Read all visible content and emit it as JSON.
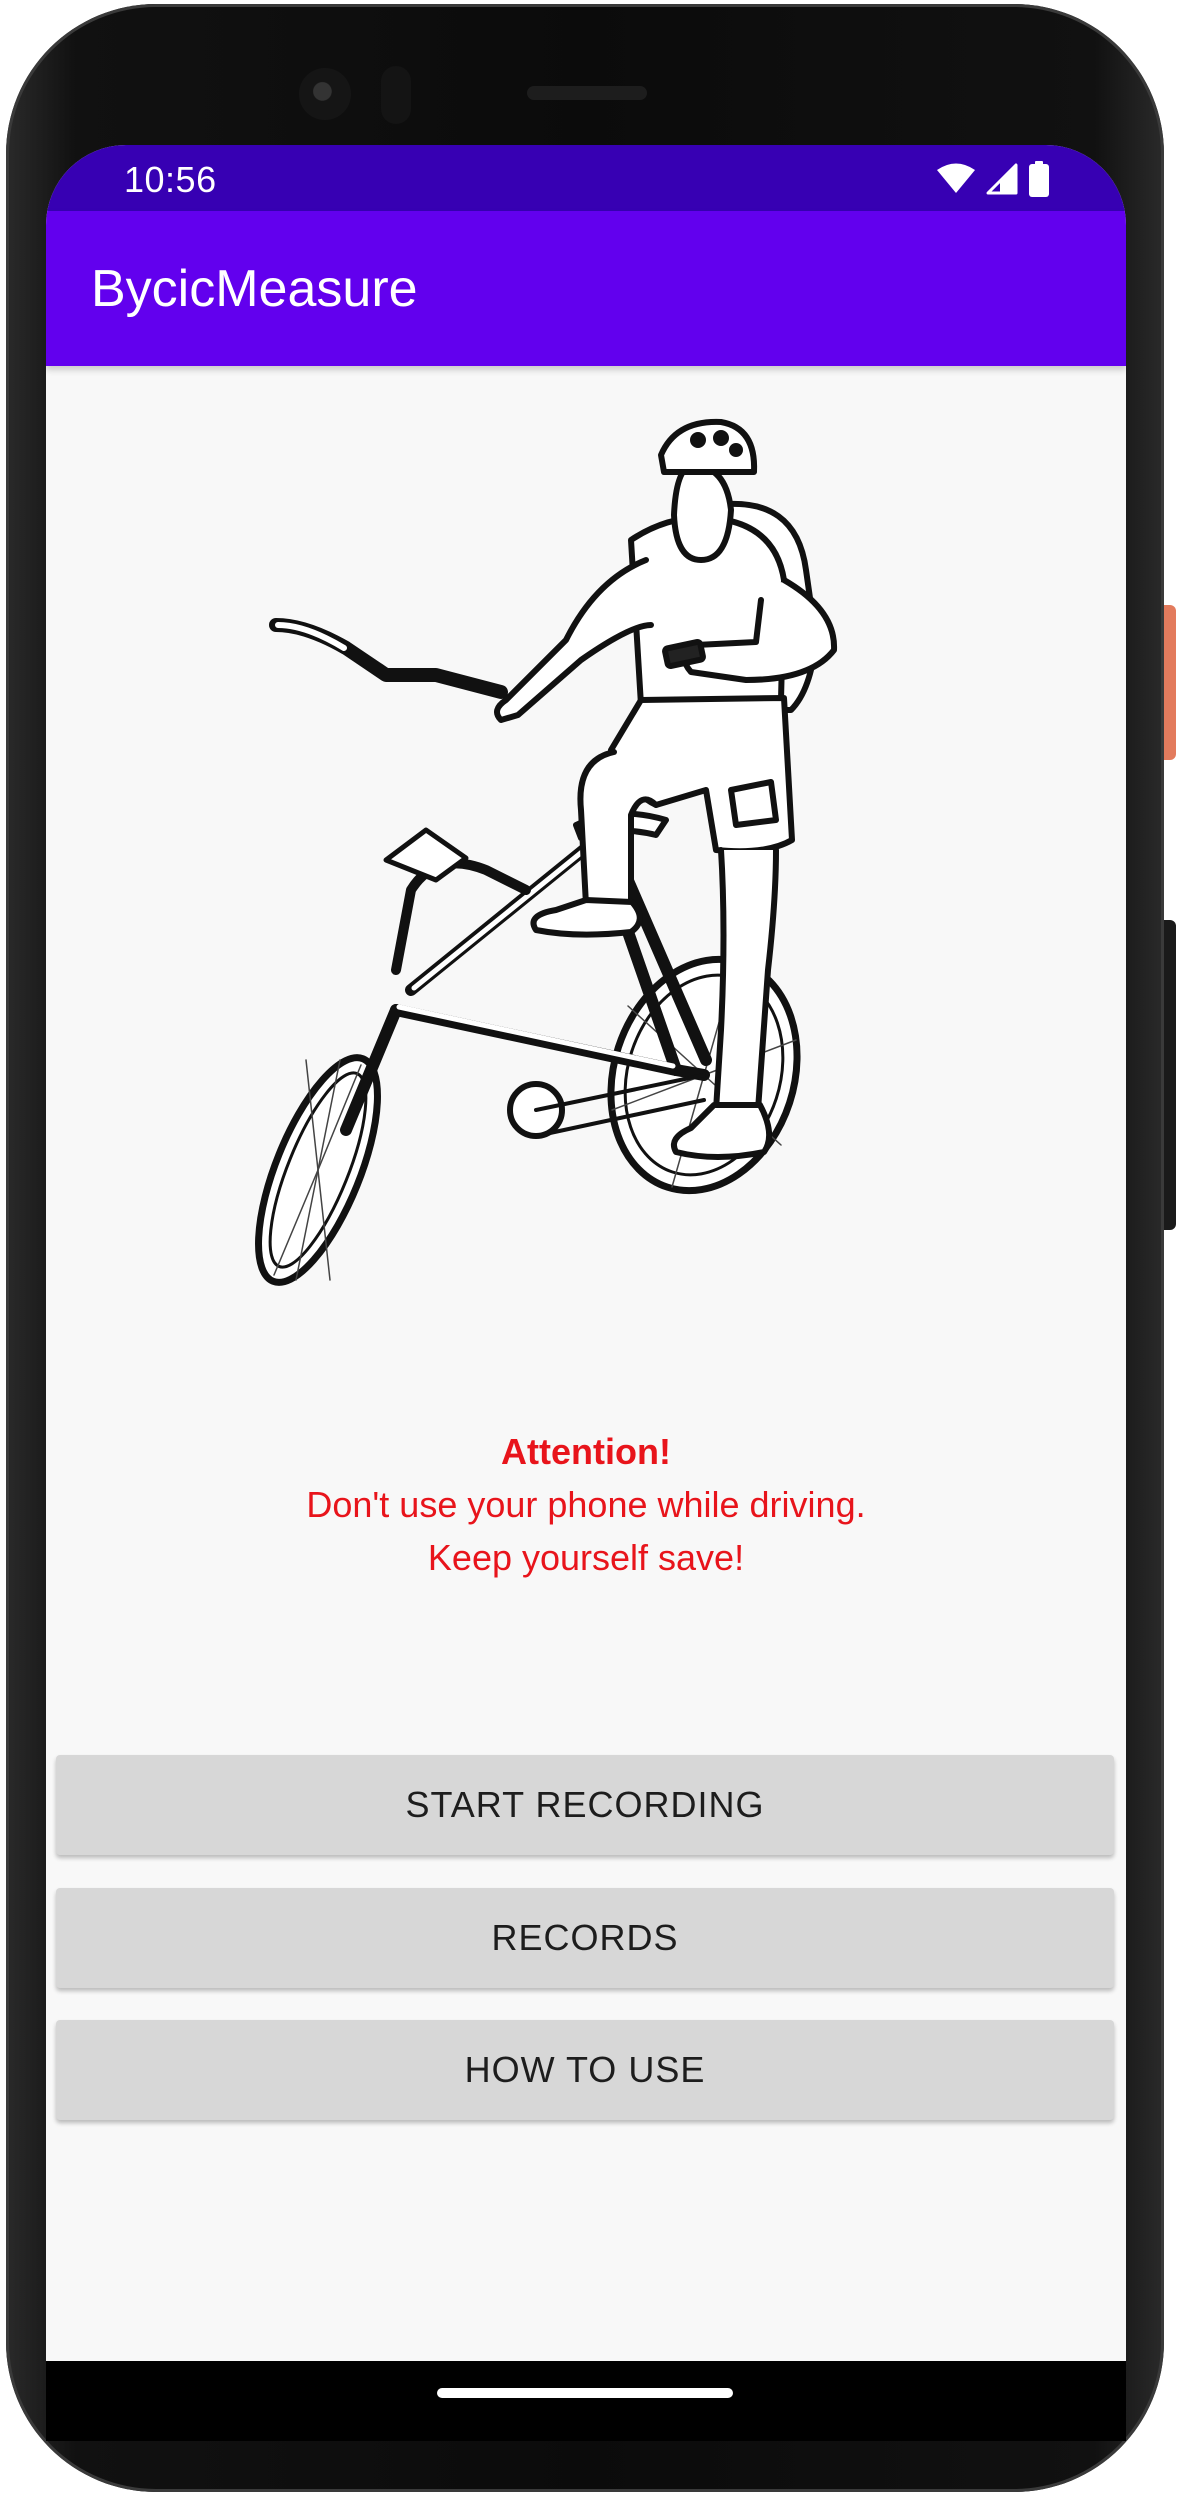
{
  "status_bar": {
    "time": "10:56",
    "icons": [
      "wifi-icon",
      "cellular-signal-icon",
      "battery-icon"
    ]
  },
  "app_bar": {
    "title": "BycicMeasure"
  },
  "hero": {
    "icon": "cyclist-with-bicycle-illustration"
  },
  "warning": {
    "title": "Attention!",
    "line1": "Don't use your phone while driving.",
    "line2": "Keep yourself save!"
  },
  "actions": {
    "start_recording": "START RECORDING",
    "records": "RECORDS",
    "how_to_use": "HOW TO USE"
  },
  "colors": {
    "status_bar": "#3700b3",
    "app_bar": "#6200ee",
    "warning_text": "#e8141b",
    "button_bg": "#d7d7d7",
    "screen_bg": "#f8f8f8"
  }
}
